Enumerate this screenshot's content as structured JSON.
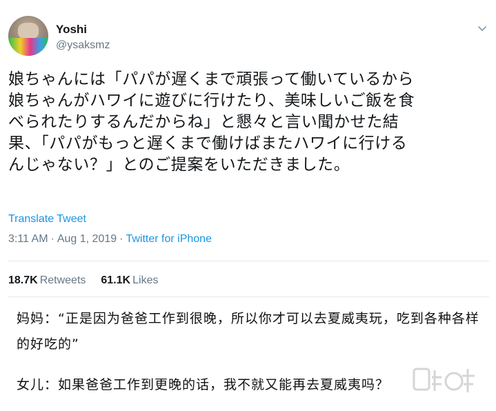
{
  "author": {
    "display_name": "Yoshi",
    "handle": "@ysaksmz"
  },
  "tweet": {
    "text": "娘ちゃんには「パパが遅くまで頑張って働いているから\n娘ちゃんがハワイに遊びに行けたり、美味しいご飯を食\nべられたりするんだからね」と懇々と言い聞かせた結\n果、「パパがもっと遅くまで働けばまたハワイに行ける\nんじゃない？」とのご提案をいただきました。",
    "translate_label": "Translate Tweet",
    "time": "3:11 AM",
    "date": "Aug 1, 2019",
    "separator": "·",
    "source": "Twitter for iPhone"
  },
  "stats": {
    "retweets_count": "18.7K",
    "retweets_label": "Retweets",
    "likes_count": "61.1K",
    "likes_label": "Likes"
  },
  "translation": {
    "mom_line": "妈妈：“正是因为爸爸工作到很晚，所以你才可以去夏威夷玩，吃到各种各样的好吃的”",
    "daughter_line": "女儿：如果爸爸工作到更晚的话，我不就又能再去夏威夷吗？"
  },
  "icons": {
    "menu": "chevron-down-icon",
    "watermark": "watermark-logo"
  },
  "colors": {
    "link": "#1b95e0",
    "secondary_text": "#657786",
    "divider": "#e1e8ed"
  }
}
